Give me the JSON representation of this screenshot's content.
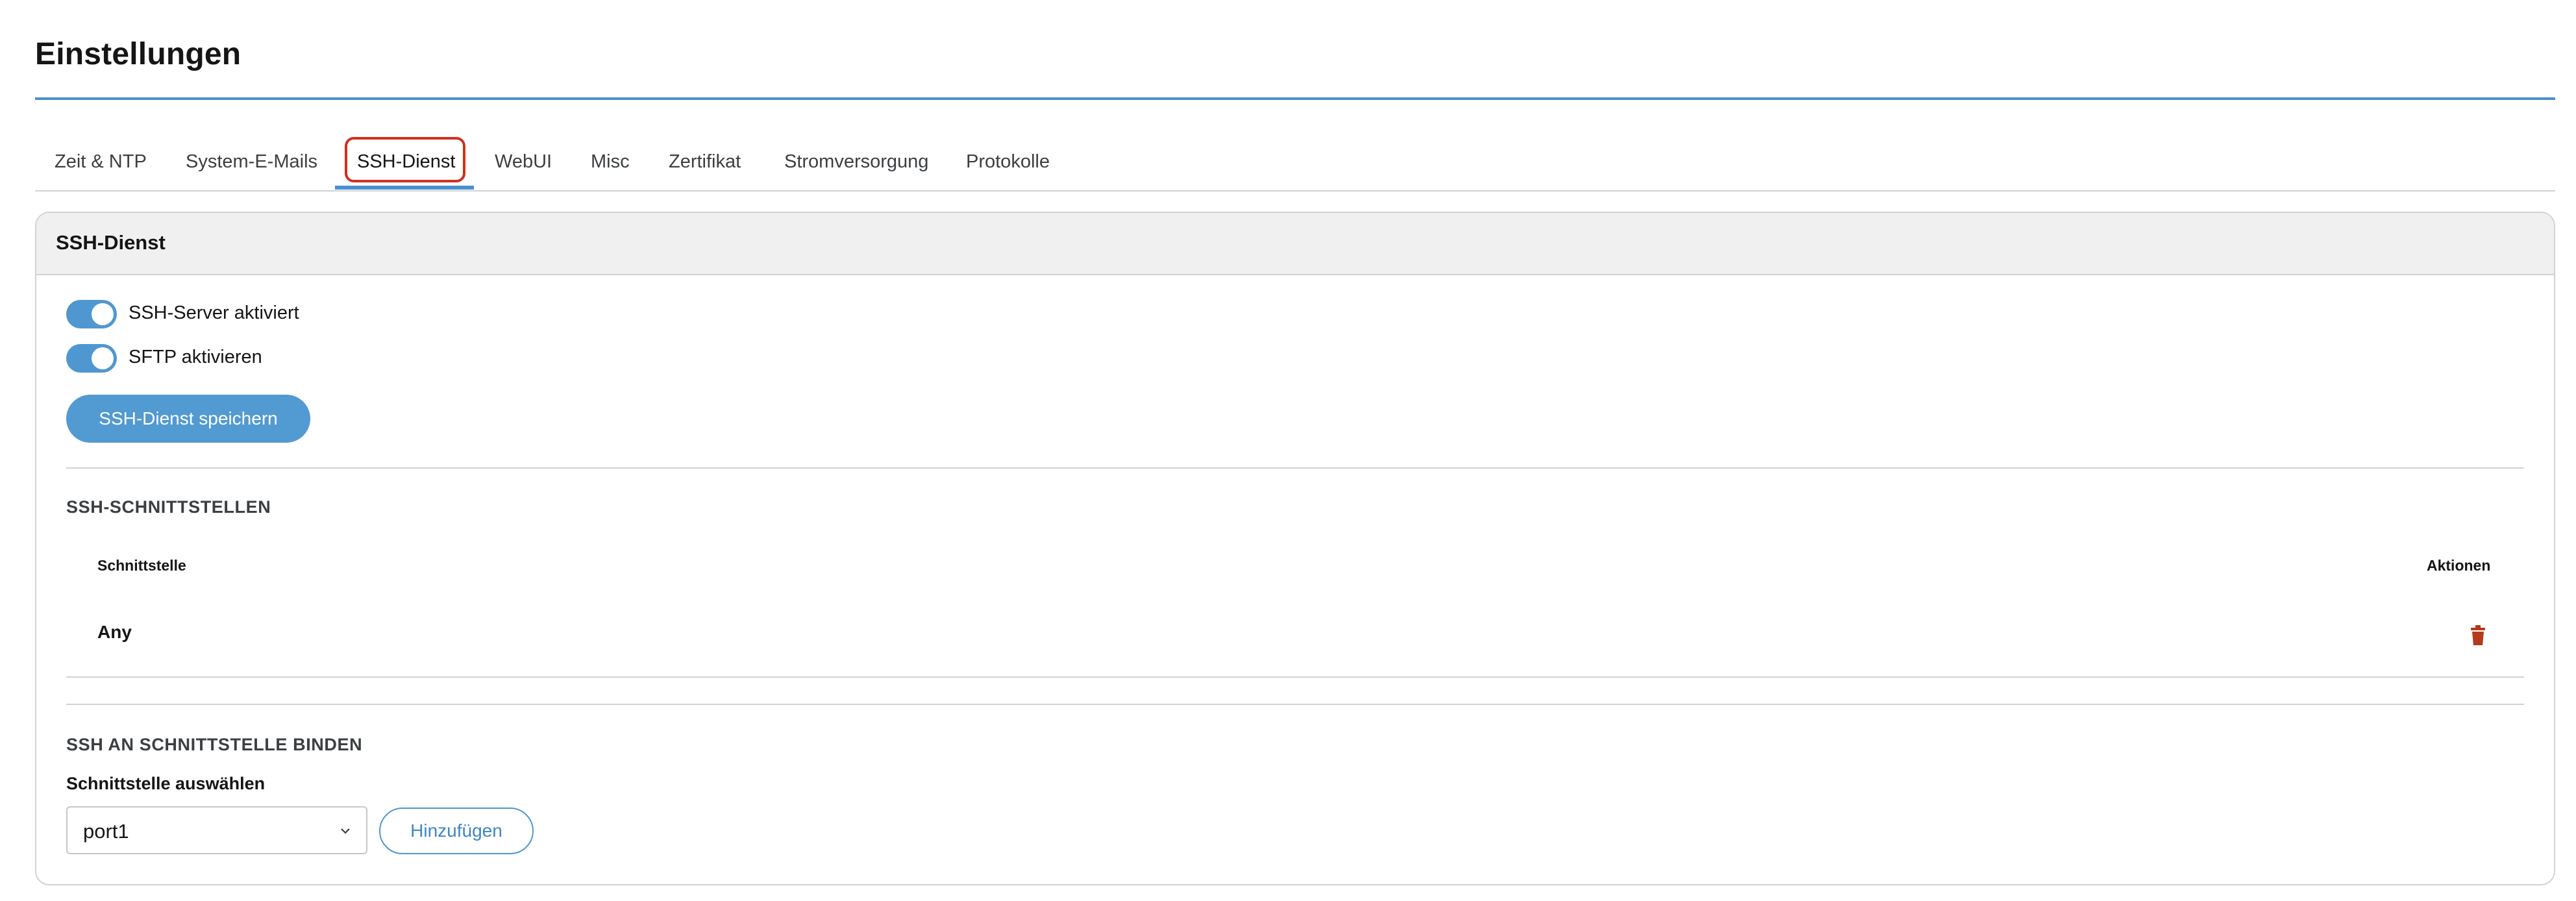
{
  "page": {
    "title": "Einstellungen"
  },
  "tabs": [
    {
      "label": "Zeit & NTP"
    },
    {
      "label": "System-E-Mails"
    },
    {
      "label": "SSH-Dienst",
      "active": true
    },
    {
      "label": "WebUI"
    },
    {
      "label": "Misc"
    },
    {
      "label": "Zertifikat"
    },
    {
      "label": "Stromversorgung"
    },
    {
      "label": "Protokolle"
    }
  ],
  "card": {
    "title": "SSH-Dienst",
    "toggles": [
      {
        "label": "SSH-Server aktiviert",
        "checked": true
      },
      {
        "label": "SFTP aktivieren",
        "checked": true
      }
    ],
    "save_label": "SSH-Dienst speichern"
  },
  "interfaces": {
    "section_title": "SSH-SCHNITTSTELLEN",
    "columns": [
      "Schnittstelle",
      "Aktionen"
    ],
    "rows": [
      {
        "interface": "Any",
        "action_icon": "trash-icon"
      }
    ]
  },
  "bind": {
    "section_title": "SSH AN SCHNITTSTELLE BINDEN",
    "field_label": "Schnittstelle auswählen",
    "selected": "port1",
    "add_label": "Hinzufügen"
  },
  "colors": {
    "accent": "#4a8fd1",
    "button": "#529ad2",
    "highlight": "#d1301f",
    "delete": "#b5391b"
  }
}
